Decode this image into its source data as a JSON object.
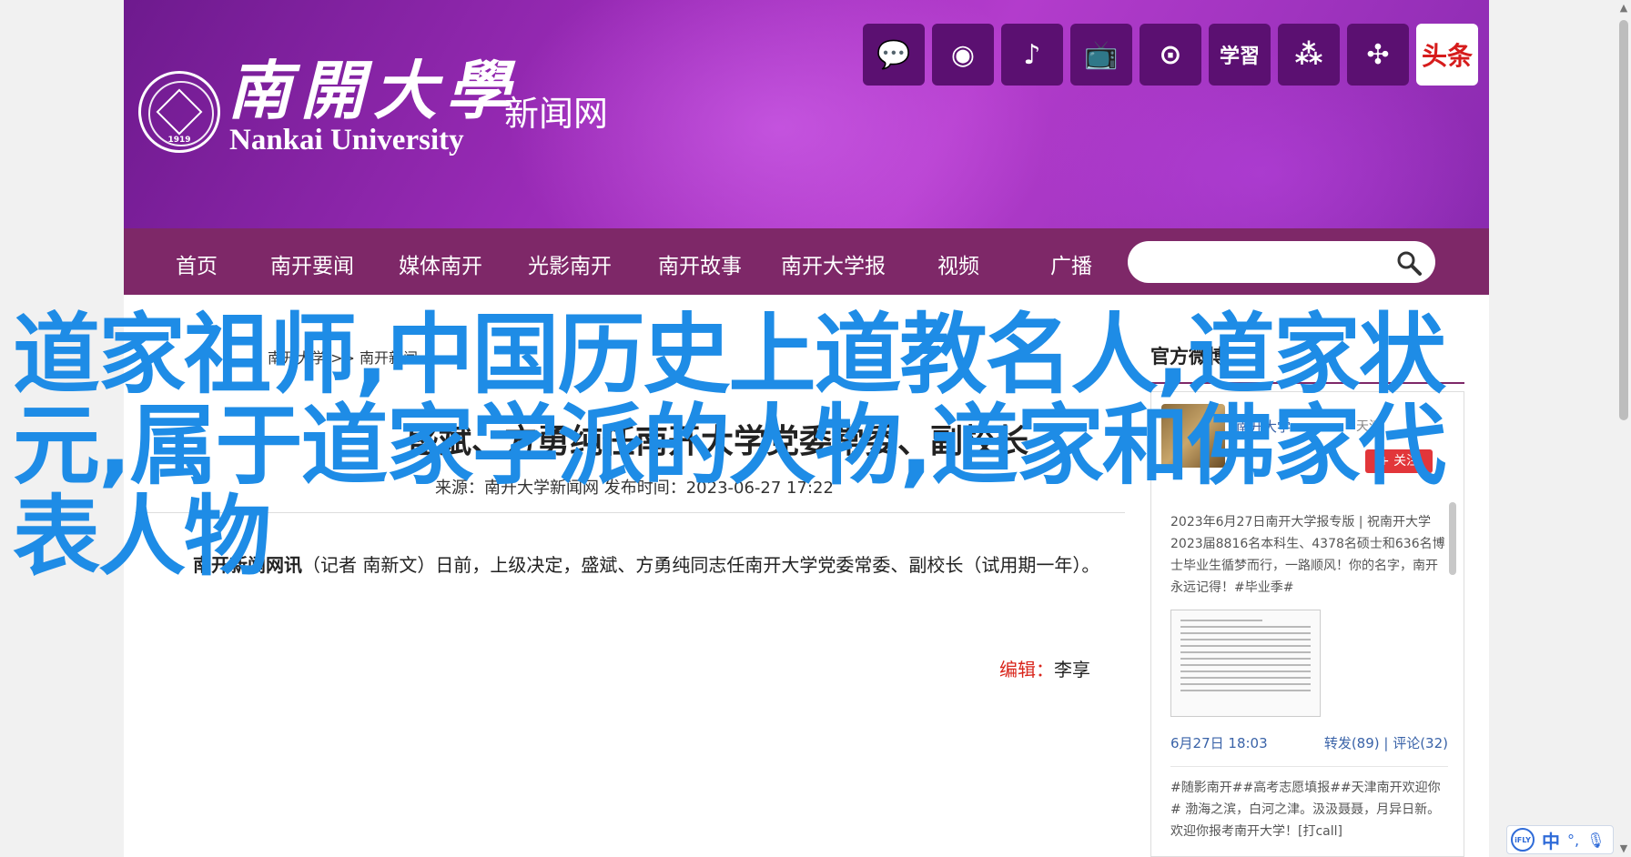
{
  "header": {
    "seal_year": "1919",
    "university_cn": "南開大學",
    "university_en": "Nankai University",
    "site_name": "新闻网",
    "social_icons": [
      {
        "name": "wechat-icon",
        "glyph": "💬"
      },
      {
        "name": "weibo-icon",
        "glyph": "◉"
      },
      {
        "name": "douyin-icon",
        "glyph": "♪"
      },
      {
        "name": "bilibili-icon",
        "glyph": "📺"
      },
      {
        "name": "kuaishou-icon",
        "glyph": "⊙"
      },
      {
        "name": "xuexi-icon",
        "glyph": "学習"
      },
      {
        "name": "app-icon",
        "glyph": "⁂"
      },
      {
        "name": "feather-icon",
        "glyph": "✣"
      },
      {
        "name": "toutiao-icon",
        "glyph": "头条"
      }
    ]
  },
  "nav": {
    "items": [
      "首页",
      "南开要闻",
      "媒体南开",
      "光影南开",
      "南开故事",
      "南开大学报",
      "视频",
      "广播"
    ],
    "search_placeholder": ""
  },
  "article": {
    "breadcrumb": "南开大学 >> 南开新闻",
    "headline": "盛斌、方勇纯任南开大学党委常委、副校长",
    "source": "来源：南开大学新闻网  发布时间：2023-06-27 17:22",
    "lead_bold": "南开新闻网讯",
    "lead_text": "（记者 南新文）日前，上级决定，盛斌、方勇纯同志任南开大学党委常委、副校长（试用期一年）。",
    "editor_label": "编辑：",
    "editor_name": "李享"
  },
  "sidebar": {
    "title": "官方微博",
    "account_name": "南开大学",
    "account_today": "天津",
    "follow_label": "+ 关注",
    "post1": "2023年6月27日南开大学报专版 | 祝南开大学2023届8816名本科生、4378名硕士和636名博士毕业生循梦而行，一路顺风！你的名字，南开永远记得！#毕业季#",
    "post1_time": "6月27日 18:03",
    "post1_stats": "转发(89)  |  评论(32)",
    "post2": "#随影南开##高考志愿填报##天津南开欢迎你#  渤海之滨，白河之津。汲汲聂聂，月异日新。欢迎你报考南开大学！[打call]"
  },
  "overlay_title": "道家祖师,中国历史上道教名人,道家状元,属于道家学派的人物,道家和佛家代表人物",
  "ime": {
    "lang": "中",
    "logo": "iFLY"
  },
  "colors": {
    "nav": "#7e2868",
    "overlay": "#1e8ce6",
    "accent_red": "#d9261c",
    "link": "#3a63a8"
  }
}
